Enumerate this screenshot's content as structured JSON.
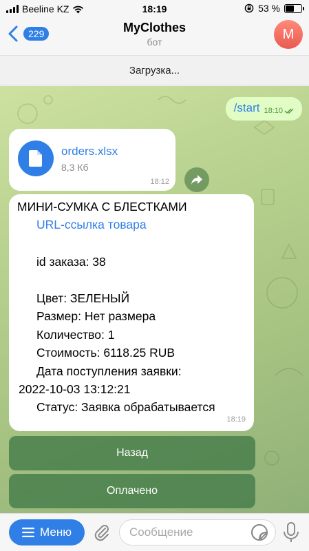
{
  "status_bar": {
    "carrier": "Beeline KZ",
    "time": "18:19",
    "battery": "53 %",
    "battery_level": 0.53,
    "icons": [
      "signal-icon",
      "wifi-icon",
      "orientation-lock-icon",
      "battery-icon"
    ]
  },
  "header": {
    "back_count": "229",
    "title": "MyClothes",
    "subtitle": "бот",
    "avatar_letter": "M",
    "avatar_color": "#ea5a4f"
  },
  "loading_text": "Загрузка...",
  "messages": {
    "outgoing": {
      "text": "/start",
      "time": "18:10"
    },
    "file": {
      "name": "orders.xlsx",
      "size": "8,3 Кб",
      "time": "18:12"
    },
    "order": {
      "title": "МИНИ-СУМКА С БЛЕСТКАМИ",
      "link": "URL-ссылка товара",
      "order_id": "id заказа: 38",
      "color": "Цвет: ЗЕЛЕНЫЙ",
      "size": "Размер: Нет размера",
      "quantity": "Количество: 1",
      "cost": "Стоимость: 6118.25 RUB",
      "date_label": "Дата поступления заявки:",
      "date_value": "2022-10-03 13:12:21",
      "status": "Статус: Заявка обрабатывается",
      "time": "18:19"
    }
  },
  "keyboard": {
    "back_label": "Назад",
    "paid_label": "Оплачено"
  },
  "input_bar": {
    "menu_label": "Меню",
    "placeholder": "Сообщение"
  },
  "colors": {
    "accent": "#2f7fe6",
    "outgoing_bubble": "#e2fcc6",
    "keyboard_button": "#467d4b"
  }
}
